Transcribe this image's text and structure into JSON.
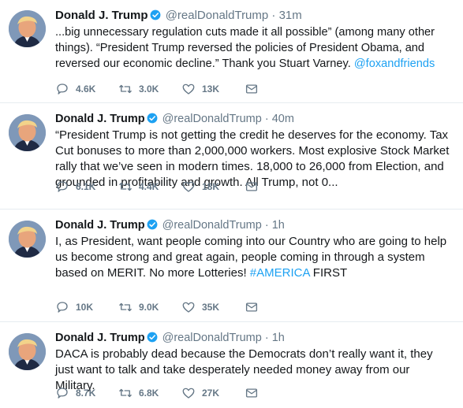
{
  "tweets": [
    {
      "name": "Donald J. Trump",
      "handle": "@realDonaldTrump",
      "separator": "·",
      "time": "31m",
      "text_before_link": "...big unnecessary regulation cuts made it all possible” (among many other things). “President Trump reversed the policies of President Obama, and reversed our economic decline.” Thank you Stuart Varney.  ",
      "link": "@foxandfriends",
      "text_after_link": "",
      "replies": "4.6K",
      "retweets": "3.0K",
      "likes": "13K"
    },
    {
      "name": "Donald J. Trump",
      "handle": "@realDonaldTrump",
      "separator": "·",
      "time": "40m",
      "text_before_link": "“President Trump is not getting the credit he deserves for the economy. Tax Cut bonuses to more than 2,000,000 workers. Most explosive Stock Market rally that we’ve seen in modern times. 18,000 to 26,000 from Election, and grounded in profitability and growth. All Trump, not 0...",
      "link": "",
      "text_after_link": "",
      "replies": "6.1K",
      "retweets": "4.4K",
      "likes": "18K"
    },
    {
      "name": "Donald J. Trump",
      "handle": "@realDonaldTrump",
      "separator": "·",
      "time": "1h",
      "text_before_link": "I, as President, want people coming into our Country who are going to help us become strong and great again, people coming in through a system based on MERIT. No more Lotteries! ",
      "link": "#AMERICA",
      "text_after_link": " FIRST",
      "replies": "10K",
      "retweets": "9.0K",
      "likes": "35K"
    },
    {
      "name": "Donald J. Trump",
      "handle": "@realDonaldTrump",
      "separator": "·",
      "time": "1h",
      "text_before_link": "DACA is probably dead because the Democrats don’t really want it, they just want to talk and take desperately needed money away from our Military.",
      "link": "",
      "text_after_link": "",
      "replies": "8.7K",
      "retweets": "6.8K",
      "likes": "27K"
    }
  ],
  "icons": {
    "reply": "reply-icon",
    "retweet": "retweet-icon",
    "like": "heart-icon",
    "dm": "envelope-icon",
    "verified": "verified-badge-icon"
  },
  "colors": {
    "link": "#1da1f2",
    "secondary_text": "#657786",
    "verified": "#1da1f2"
  }
}
